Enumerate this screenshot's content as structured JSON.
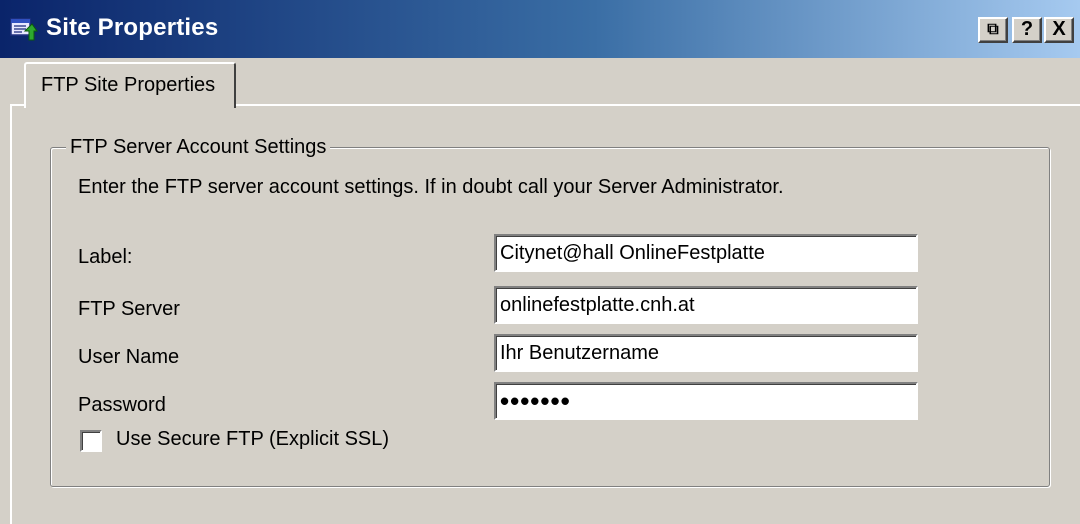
{
  "window": {
    "title": "Site Properties",
    "controls": {
      "restore": "⧉",
      "help": "?",
      "close": "X"
    }
  },
  "tabs": [
    {
      "label": "FTP Site Properties",
      "active": true
    }
  ],
  "group": {
    "title": "FTP Server Account Settings",
    "instructions": "Enter the FTP server account settings. If in doubt call your Server Administrator."
  },
  "fields": {
    "label": {
      "label": "Label:",
      "value": "Citynet@hall OnlineFestplatte"
    },
    "server": {
      "label": "FTP Server",
      "value": "onlinefestplatte.cnh.at"
    },
    "username": {
      "label": "User Name",
      "value": "Ihr Benutzername"
    },
    "password": {
      "label": "Password",
      "value": "•••••••"
    }
  },
  "options": {
    "secure_ftp": {
      "label": "Use Secure FTP (Explicit SSL)",
      "checked": false
    }
  },
  "colors": {
    "titlebar_start": "#0a246a",
    "titlebar_end": "#a6caf0",
    "face": "#d4d0c8"
  }
}
